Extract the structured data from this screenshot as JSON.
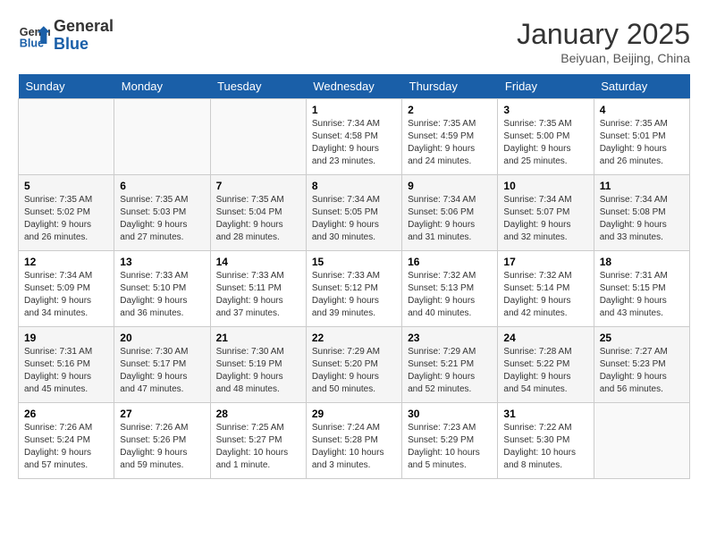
{
  "header": {
    "logo_line1": "General",
    "logo_line2": "Blue",
    "month": "January 2025",
    "location": "Beiyuan, Beijing, China"
  },
  "weekdays": [
    "Sunday",
    "Monday",
    "Tuesday",
    "Wednesday",
    "Thursday",
    "Friday",
    "Saturday"
  ],
  "weeks": [
    [
      {
        "day": "",
        "info": ""
      },
      {
        "day": "",
        "info": ""
      },
      {
        "day": "",
        "info": ""
      },
      {
        "day": "1",
        "info": "Sunrise: 7:34 AM\nSunset: 4:58 PM\nDaylight: 9 hours\nand 23 minutes."
      },
      {
        "day": "2",
        "info": "Sunrise: 7:35 AM\nSunset: 4:59 PM\nDaylight: 9 hours\nand 24 minutes."
      },
      {
        "day": "3",
        "info": "Sunrise: 7:35 AM\nSunset: 5:00 PM\nDaylight: 9 hours\nand 25 minutes."
      },
      {
        "day": "4",
        "info": "Sunrise: 7:35 AM\nSunset: 5:01 PM\nDaylight: 9 hours\nand 26 minutes."
      }
    ],
    [
      {
        "day": "5",
        "info": "Sunrise: 7:35 AM\nSunset: 5:02 PM\nDaylight: 9 hours\nand 26 minutes."
      },
      {
        "day": "6",
        "info": "Sunrise: 7:35 AM\nSunset: 5:03 PM\nDaylight: 9 hours\nand 27 minutes."
      },
      {
        "day": "7",
        "info": "Sunrise: 7:35 AM\nSunset: 5:04 PM\nDaylight: 9 hours\nand 28 minutes."
      },
      {
        "day": "8",
        "info": "Sunrise: 7:34 AM\nSunset: 5:05 PM\nDaylight: 9 hours\nand 30 minutes."
      },
      {
        "day": "9",
        "info": "Sunrise: 7:34 AM\nSunset: 5:06 PM\nDaylight: 9 hours\nand 31 minutes."
      },
      {
        "day": "10",
        "info": "Sunrise: 7:34 AM\nSunset: 5:07 PM\nDaylight: 9 hours\nand 32 minutes."
      },
      {
        "day": "11",
        "info": "Sunrise: 7:34 AM\nSunset: 5:08 PM\nDaylight: 9 hours\nand 33 minutes."
      }
    ],
    [
      {
        "day": "12",
        "info": "Sunrise: 7:34 AM\nSunset: 5:09 PM\nDaylight: 9 hours\nand 34 minutes."
      },
      {
        "day": "13",
        "info": "Sunrise: 7:33 AM\nSunset: 5:10 PM\nDaylight: 9 hours\nand 36 minutes."
      },
      {
        "day": "14",
        "info": "Sunrise: 7:33 AM\nSunset: 5:11 PM\nDaylight: 9 hours\nand 37 minutes."
      },
      {
        "day": "15",
        "info": "Sunrise: 7:33 AM\nSunset: 5:12 PM\nDaylight: 9 hours\nand 39 minutes."
      },
      {
        "day": "16",
        "info": "Sunrise: 7:32 AM\nSunset: 5:13 PM\nDaylight: 9 hours\nand 40 minutes."
      },
      {
        "day": "17",
        "info": "Sunrise: 7:32 AM\nSunset: 5:14 PM\nDaylight: 9 hours\nand 42 minutes."
      },
      {
        "day": "18",
        "info": "Sunrise: 7:31 AM\nSunset: 5:15 PM\nDaylight: 9 hours\nand 43 minutes."
      }
    ],
    [
      {
        "day": "19",
        "info": "Sunrise: 7:31 AM\nSunset: 5:16 PM\nDaylight: 9 hours\nand 45 minutes."
      },
      {
        "day": "20",
        "info": "Sunrise: 7:30 AM\nSunset: 5:17 PM\nDaylight: 9 hours\nand 47 minutes."
      },
      {
        "day": "21",
        "info": "Sunrise: 7:30 AM\nSunset: 5:19 PM\nDaylight: 9 hours\nand 48 minutes."
      },
      {
        "day": "22",
        "info": "Sunrise: 7:29 AM\nSunset: 5:20 PM\nDaylight: 9 hours\nand 50 minutes."
      },
      {
        "day": "23",
        "info": "Sunrise: 7:29 AM\nSunset: 5:21 PM\nDaylight: 9 hours\nand 52 minutes."
      },
      {
        "day": "24",
        "info": "Sunrise: 7:28 AM\nSunset: 5:22 PM\nDaylight: 9 hours\nand 54 minutes."
      },
      {
        "day": "25",
        "info": "Sunrise: 7:27 AM\nSunset: 5:23 PM\nDaylight: 9 hours\nand 56 minutes."
      }
    ],
    [
      {
        "day": "26",
        "info": "Sunrise: 7:26 AM\nSunset: 5:24 PM\nDaylight: 9 hours\nand 57 minutes."
      },
      {
        "day": "27",
        "info": "Sunrise: 7:26 AM\nSunset: 5:26 PM\nDaylight: 9 hours\nand 59 minutes."
      },
      {
        "day": "28",
        "info": "Sunrise: 7:25 AM\nSunset: 5:27 PM\nDaylight: 10 hours\nand 1 minute."
      },
      {
        "day": "29",
        "info": "Sunrise: 7:24 AM\nSunset: 5:28 PM\nDaylight: 10 hours\nand 3 minutes."
      },
      {
        "day": "30",
        "info": "Sunrise: 7:23 AM\nSunset: 5:29 PM\nDaylight: 10 hours\nand 5 minutes."
      },
      {
        "day": "31",
        "info": "Sunrise: 7:22 AM\nSunset: 5:30 PM\nDaylight: 10 hours\nand 8 minutes."
      },
      {
        "day": "",
        "info": ""
      }
    ]
  ]
}
